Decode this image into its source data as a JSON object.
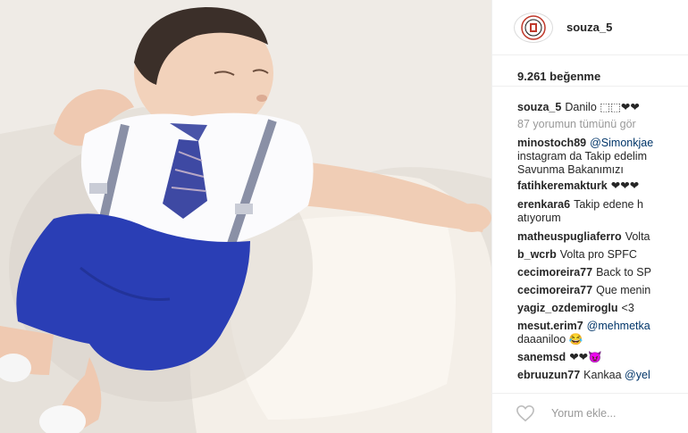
{
  "post": {
    "username": "souza_5",
    "likes_label": "9.261 beğenme",
    "add_comment_placeholder": "Yorum ekle..."
  },
  "caption": {
    "username": "souza_5",
    "text": "Danilo ⬚⬚❤❤"
  },
  "view_all_comments": "87 yorumun tümünü gör",
  "comments": [
    {
      "username": "minostoch89",
      "mention": "@Simonkjae",
      "lines": [
        "instagram da Takip edelim",
        "Savunma Bakanımızı"
      ]
    },
    {
      "username": "fatihkeremakturk",
      "text": "❤❤❤"
    },
    {
      "username": "erenkara6",
      "text": "Takip edene h",
      "lines": [
        "atıyorum"
      ]
    },
    {
      "username": "matheuspugliaferro",
      "text": "Volta"
    },
    {
      "username": "b_wcrb",
      "text": "Volta pro SPFC"
    },
    {
      "username": "cecimoreira77",
      "text": "Back to SP"
    },
    {
      "username": "cecimoreira77",
      "text": "Que menin"
    },
    {
      "username": "yagiz_ozdemiroglu",
      "text": "<3"
    },
    {
      "username": "mesut.erim7",
      "mention": "@mehmetka",
      "lines": [
        "daaaniloo 😂"
      ]
    },
    {
      "username": "sanemsd",
      "text": "❤❤😈"
    },
    {
      "username": "ebruuzun77",
      "text": "Kankaa",
      "mention": "@yel"
    }
  ],
  "icons": {
    "avatar": "club-crest-icon",
    "like": "heart-outline-icon"
  }
}
